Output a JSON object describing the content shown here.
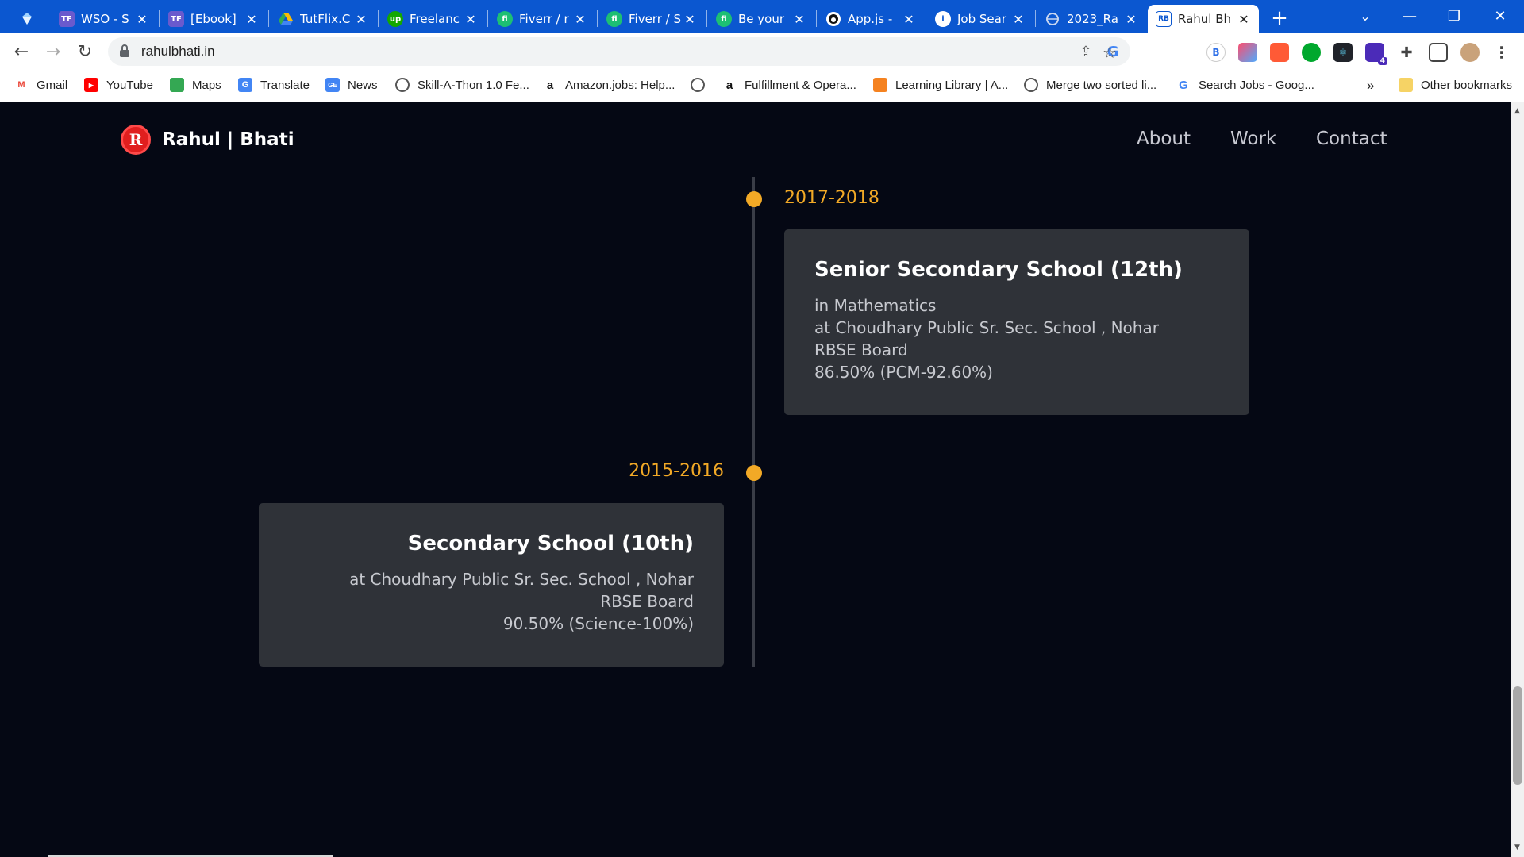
{
  "browser": {
    "tabs": [
      {
        "title": "",
        "active": false
      },
      {
        "title": "WSO - S",
        "active": false
      },
      {
        "title": "[Ebook]",
        "active": false
      },
      {
        "title": "TutFlix.C",
        "active": false
      },
      {
        "title": "Freelanc",
        "active": false
      },
      {
        "title": "Fiverr / r",
        "active": false
      },
      {
        "title": "Fiverr / S",
        "active": false
      },
      {
        "title": "Be your",
        "active": false
      },
      {
        "title": "App.js -",
        "active": false
      },
      {
        "title": "Job Sear",
        "active": false
      },
      {
        "title": "2023_Ra",
        "active": false
      },
      {
        "title": "Rahul Bh",
        "active": true
      }
    ],
    "tab_favicons": [
      "",
      "TF",
      "TF",
      "",
      "up",
      "fi",
      "fi",
      "fi",
      "",
      "i",
      "",
      "RB"
    ],
    "close_glyph": "✕",
    "new_tab_glyph": "+",
    "url": "rahulbhati.in",
    "bookmarks": [
      "Gmail",
      "YouTube",
      "Maps",
      "Translate",
      "News",
      "Skill-A-Thon 1.0 Fe...",
      "Amazon.jobs: Help...",
      "",
      "Fulfillment & Opera...",
      "Learning Library | A...",
      "Merge two sorted li...",
      "Search Jobs - Goog..."
    ],
    "bookmarks_overflow": "»",
    "other_bookmarks": "Other bookmarks",
    "profile_extension_badge": "4"
  },
  "site": {
    "logo_letter": "R",
    "logo_text": "Rahul | Bhati",
    "nav": [
      "About",
      "Work",
      "Contact"
    ]
  },
  "timeline": [
    {
      "year": "2017-2018",
      "side": "right",
      "title": "Senior Secondary School (12th)",
      "lines": [
        "in Mathematics",
        "at Choudhary Public Sr. Sec. School , Nohar",
        "RBSE Board",
        "86.50% (PCM-92.60%)"
      ]
    },
    {
      "year": "2015-2016",
      "side": "left",
      "title": "Secondary School (10th)",
      "lines": [
        "at Choudhary Public Sr. Sec. School , Nohar",
        "RBSE Board",
        "90.50% (Science-100%)"
      ]
    }
  ],
  "colors": {
    "accent": "#f2a926",
    "background": "#050814",
    "card": "#2f3238",
    "chrome": "#0b57d0"
  }
}
